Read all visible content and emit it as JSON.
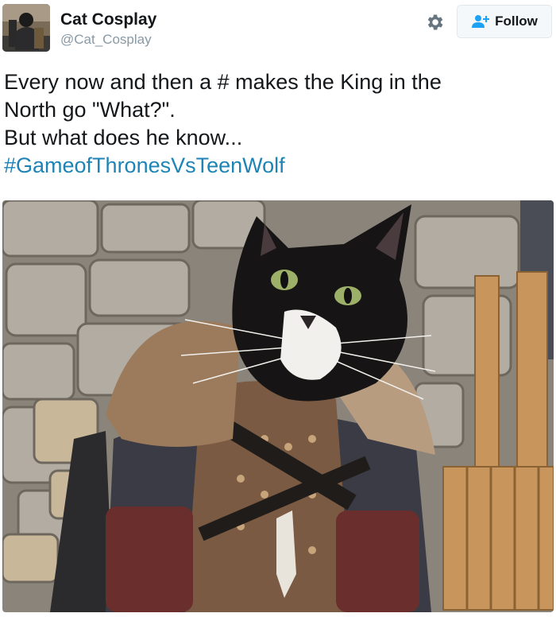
{
  "user": {
    "name": "Cat Cosplay",
    "handle": "@Cat_Cosplay"
  },
  "actions": {
    "follow_label": "Follow",
    "gear_icon": "gear-icon",
    "follow_icon": "add-user-icon"
  },
  "tweet": {
    "line1": "Every now and then a # makes the King in the",
    "line2": "North go \"What?\".",
    "line3": "But what does he know...",
    "hashtag": "#GameofThronesVsTeenWolf"
  },
  "colors": {
    "hashtag": "#1d84b5",
    "handle": "#8899a6",
    "button_bg": "#f5f8fa"
  }
}
